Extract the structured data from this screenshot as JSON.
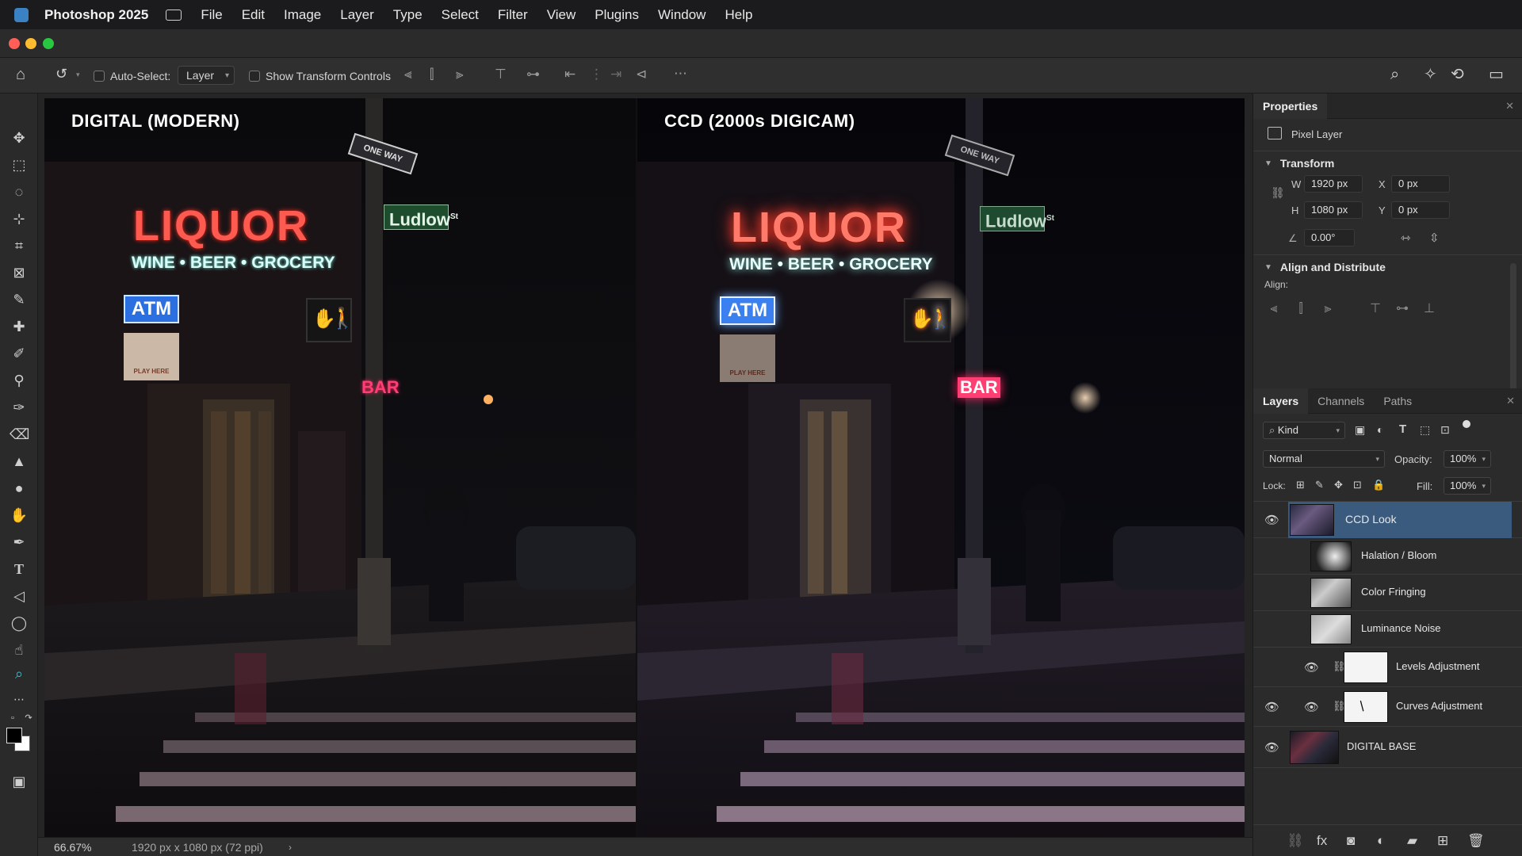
{
  "menubar": {
    "app_name": "Photoshop 2025",
    "items": [
      "File",
      "Edit",
      "Image",
      "Layer",
      "Type",
      "Select",
      "Filter",
      "View",
      "Plugins",
      "Window",
      "Help"
    ]
  },
  "optionsbar": {
    "auto_select_label": "Auto-Select:",
    "auto_select_target": "Layer",
    "show_transform_label": "Show Transform Controls"
  },
  "canvas": {
    "left_label": "DIGITAL (MODERN)",
    "right_label": "CCD (2000s DIGICAM)",
    "signs": {
      "liquor": "LIQUOR",
      "wine": "WINE • BEER • GROCERY",
      "atm": "ATM",
      "bar": "BAR",
      "street": "Ludlow",
      "street_suffix": "St",
      "oneway": "ONE WAY",
      "playhere": "PLAY HERE"
    }
  },
  "status": {
    "zoom": "66.67%",
    "doc_info": "1920 px x 1080 px (72 ppi)"
  },
  "properties": {
    "tab": "Properties",
    "layer_type": "Pixel Layer",
    "transform": {
      "title": "Transform",
      "w_label": "W",
      "w_value": "1920 px",
      "h_label": "H",
      "h_value": "1080 px",
      "x_label": "X",
      "x_value": "0 px",
      "y_label": "Y",
      "y_value": "0 px",
      "angle": "0.00°"
    },
    "align": {
      "title": "Align and Distribute",
      "label": "Align:"
    }
  },
  "layers_panel": {
    "tabs": [
      "Layers",
      "Channels",
      "Paths"
    ],
    "filter_kind": "Kind",
    "blend_mode": "Normal",
    "opacity_label": "Opacity:",
    "opacity_value": "100%",
    "lock_label": "Lock:",
    "fill_label": "Fill:",
    "fill_value": "100%",
    "layers": [
      {
        "name": "CCD Look",
        "visible": true,
        "selected": true,
        "group": true
      },
      {
        "name": "Halation / Bloom",
        "visible": false
      },
      {
        "name": "Color Fringing",
        "visible": false
      },
      {
        "name": "Luminance Noise",
        "visible": false
      },
      {
        "name": "Levels Adjustment",
        "visible": true,
        "adjustment": true
      },
      {
        "name": "Curves Adjustment",
        "visible": true,
        "adjustment": true
      },
      {
        "name": "DIGITAL BASE",
        "visible": true
      }
    ]
  },
  "colors": {
    "accent_selected": "#3b5b7e",
    "neon_red": "#ff3b3b",
    "neon_cyan": "#a8ffff",
    "atm_blue": "#2c6fe0",
    "bar_pink": "#ff3f73"
  }
}
